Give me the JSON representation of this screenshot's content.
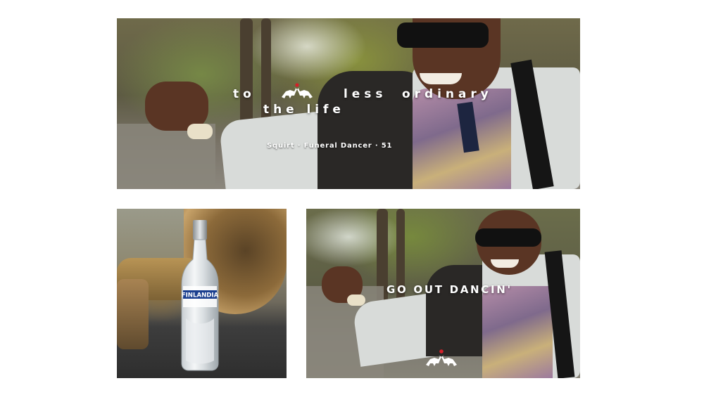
{
  "banner": {
    "headline_words": [
      "to",
      "less",
      "ordinary"
    ],
    "headline_line2": "the life",
    "caption": "Squirt · Funeral Dancer · 51"
  },
  "bottle": {
    "brand": "FINLANDIA"
  },
  "right_panel": {
    "slogan": "GO OUT DANCIN'"
  },
  "colors": {
    "background": "#ffffff",
    "text": "#ffffff",
    "logo_dot": "#d4202a",
    "bottle_label": "#1b3f8f"
  },
  "icons": [
    "finlandia-reindeer-logo"
  ]
}
